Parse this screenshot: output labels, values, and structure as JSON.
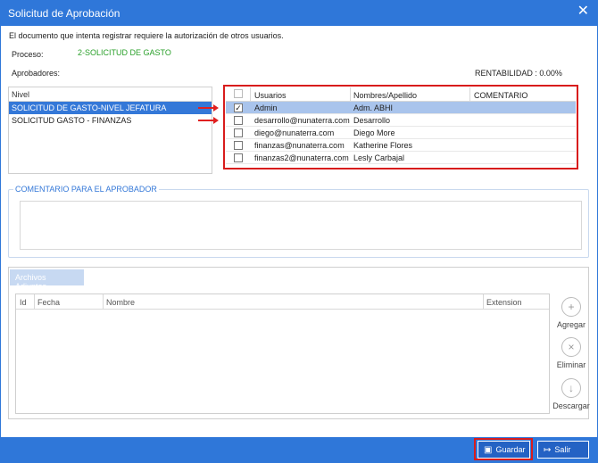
{
  "window": {
    "title": "Solicitud de Aprobación"
  },
  "info_text": "El documento que intenta registrar requiere la autorización de otros usuarios.",
  "proceso": {
    "label": "Proceso:",
    "value": "2-SOLICITUD DE GASTO"
  },
  "aprobadores_label": "Aprobadores:",
  "rentabilidad": "RENTABILIDAD : 0.00%",
  "nivel_grid": {
    "header": "Nivel",
    "rows": [
      "SOLICITUD DE GASTO-NIVEL JEFATURA",
      "SOLICITUD GASTO - FINANZAS"
    ],
    "selected_index": 0
  },
  "users_grid": {
    "headers": {
      "usuarios": "Usuarios",
      "nombres": "Nombres/Apellido",
      "comentario": "COMENTARIO"
    },
    "rows": [
      {
        "checked": true,
        "check_mark": "✓",
        "usuario": "Admin",
        "nombre": "Adm. ABHI",
        "comentario": ""
      },
      {
        "checked": false,
        "check_mark": "",
        "usuario": "desarrollo@nunaterra.com",
        "nombre": "Desarrollo",
        "comentario": ""
      },
      {
        "checked": false,
        "check_mark": "",
        "usuario": "diego@nunaterra.com",
        "nombre": "Diego More",
        "comentario": ""
      },
      {
        "checked": false,
        "check_mark": "",
        "usuario": "finanzas@nunaterra.com",
        "nombre": "Katherine Flores",
        "comentario": ""
      },
      {
        "checked": false,
        "check_mark": "",
        "usuario": "finanzas2@nunaterra.com",
        "nombre": "Lesly Carbajal",
        "comentario": ""
      }
    ]
  },
  "comentario_group": {
    "legend": "COMENTARIO PARA EL APROBADOR",
    "value": ""
  },
  "adjuntos": {
    "tab": "Archivos Adjuntos",
    "headers": {
      "id": "Id",
      "fecha": "Fecha",
      "nombre": "Nombre",
      "extension": "Extension"
    },
    "buttons": {
      "agregar": "Agregar",
      "eliminar": "Eliminar",
      "descargar": "Descargar"
    },
    "icons": {
      "agregar": "file-add-icon",
      "eliminar": "file-delete-icon",
      "descargar": "file-download-icon"
    }
  },
  "footer": {
    "guardar": "Guardar",
    "salir": "Salir",
    "icons": {
      "guardar": "save-icon",
      "salir": "exit-icon"
    }
  },
  "colors": {
    "titlebar": "#2f77d9",
    "selected_row": "#3478d8",
    "highlight_border": "#d81c1c",
    "green_value": "#2aa02a"
  }
}
